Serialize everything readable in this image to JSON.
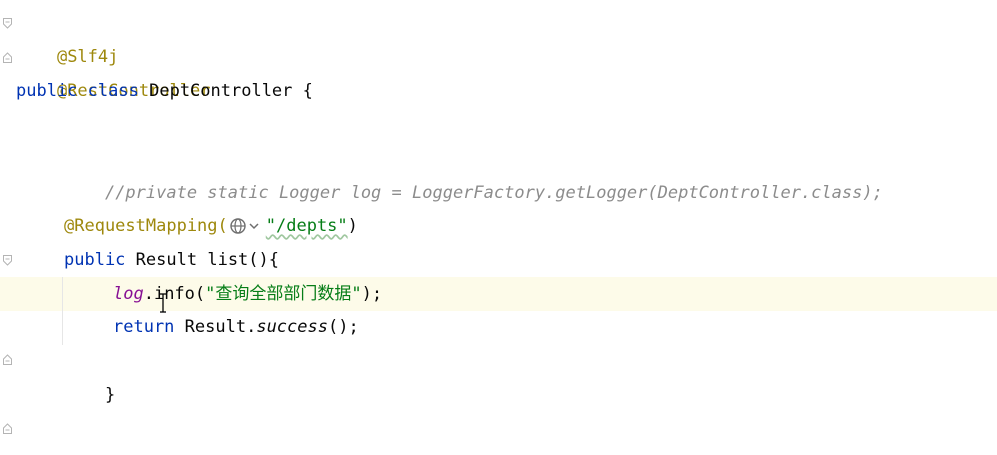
{
  "code": {
    "line1": {
      "annotation": "@Slf4j"
    },
    "line2": {
      "annotation": "@RestController"
    },
    "line3": {
      "kw_public": "public",
      "kw_class": "class",
      "class_name": "DeptController",
      "brace": "{"
    },
    "line5": {
      "comment": "//private static Logger log = LoggerFactory.getLogger(DeptController.class);"
    },
    "line7": {
      "annotation": "@RequestMapping(",
      "url": "\"/depts\"",
      "close": ")"
    },
    "line8": {
      "kw_public": "public",
      "type": "Result",
      "method": "list(){"
    },
    "line9": {
      "field": "log",
      "dot_method": ".info(",
      "string": "\"查询全部部门数据\"",
      "end": ");"
    },
    "line10": {
      "kw_return": "return",
      "type": "Result.",
      "static_method": "success",
      "end": "();"
    },
    "line11": {
      "brace": "}"
    },
    "line13": {
      "brace": "}"
    }
  },
  "icons": {
    "fold": "fold-marker-icon",
    "globe": "globe-icon",
    "chevron": "chevron-down-icon",
    "caret": "text-cursor-icon"
  },
  "colors": {
    "annotation": "#9e880d",
    "keyword": "#0033b3",
    "comment": "#8c8c8c",
    "string": "#067d17",
    "field": "#871094",
    "current_line": "#fdfbe9"
  }
}
